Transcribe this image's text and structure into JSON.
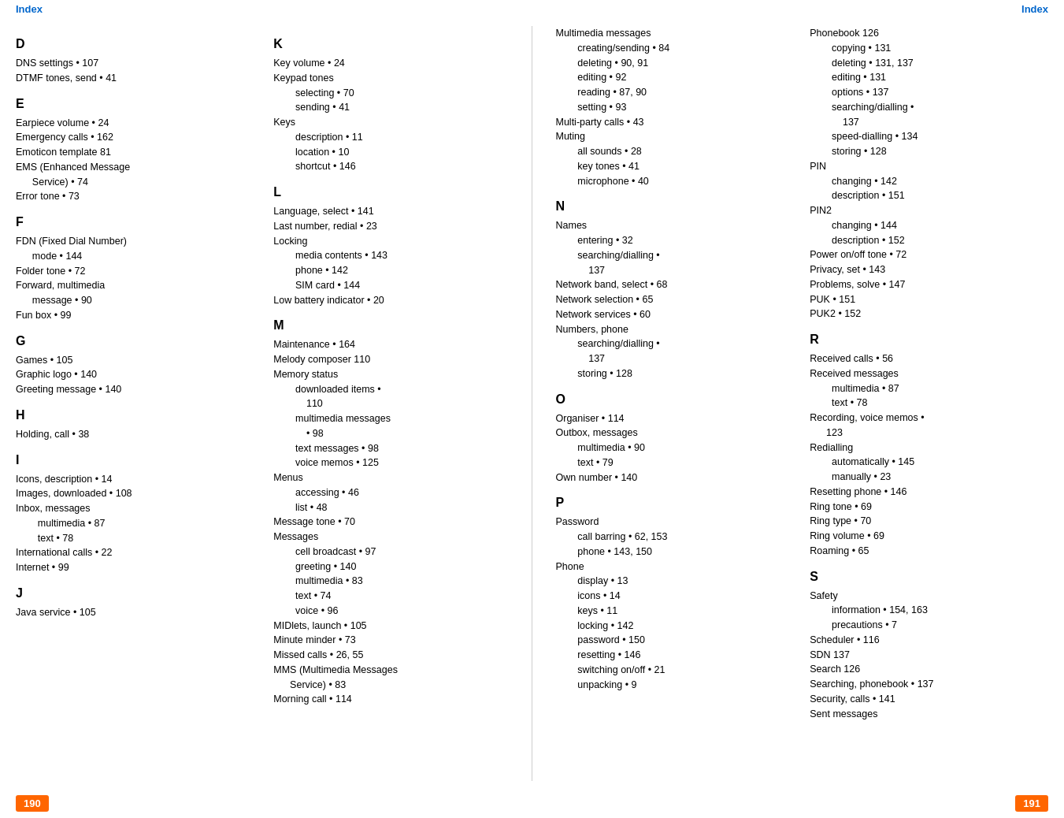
{
  "header": {
    "left_index": "Index",
    "right_index": "Index"
  },
  "footer": {
    "left_page": "190",
    "right_page": "191"
  },
  "left_page": {
    "sections": [
      {
        "letter": "D",
        "entries": [
          "DNS settings • 107",
          "DTMF tones, send • 41"
        ]
      },
      {
        "letter": "E",
        "entries": [
          "Earpiece volume • 24",
          "Emergency calls • 162",
          "Emoticon template 81",
          "EMS (Enhanced Message\n      Service) • 74",
          "Error tone • 73"
        ]
      },
      {
        "letter": "F",
        "entries": [
          "FDN (Fixed Dial Number)\n      mode • 144",
          "Folder tone • 72",
          "Forward, multimedia\n      message • 90",
          "Fun box • 99"
        ]
      },
      {
        "letter": "G",
        "entries": [
          "Games • 105",
          "Graphic logo • 140",
          "Greeting message • 140"
        ]
      },
      {
        "letter": "H",
        "entries": [
          "Holding, call • 38"
        ]
      },
      {
        "letter": "I",
        "entries": [
          "Icons, description • 14",
          "Images, downloaded • 108",
          "Inbox, messages",
          "      multimedia • 87",
          "      text • 78",
          "International calls • 22",
          "Internet • 99"
        ]
      },
      {
        "letter": "J",
        "entries": [
          "Java service • 105"
        ]
      }
    ],
    "K_section": {
      "letter": "K",
      "entries": [
        "Key volume • 24",
        "Keypad tones",
        "      selecting • 70",
        "      sending • 41",
        "Keys",
        "      description • 11",
        "      location • 10",
        "      shortcut • 146"
      ]
    },
    "L_section": {
      "letter": "L",
      "entries": [
        "Language, select • 141",
        "Last number, redial • 23",
        "Locking",
        "      media contents • 143",
        "      phone • 142",
        "      SIM card • 144",
        "Low battery indicator • 20"
      ]
    },
    "M_section": {
      "letter": "M",
      "entries": [
        "Maintenance • 164",
        "Melody composer 110",
        "Memory status",
        "      downloaded items •\n            110",
        "      multimedia messages\n            • 98",
        "      text messages • 98",
        "      voice memos • 125",
        "Menus",
        "      accessing • 46",
        "      list • 48",
        "Message tone • 70",
        "Messages",
        "      cell broadcast • 97",
        "      greeting • 140",
        "      multimedia • 83",
        "      text • 74",
        "      voice • 96",
        "MIDlets, launch • 105",
        "Minute minder • 73",
        "Missed calls • 26, 55",
        "MMS (Multimedia Messages\n      Service) • 83",
        "Morning call • 114"
      ]
    }
  },
  "right_page": {
    "multimedia_section": {
      "entries": [
        "Multimedia messages",
        "      creating/sending • 84",
        "      deleting • 90, 91",
        "      editing • 92",
        "      reading • 87, 90",
        "      setting • 93",
        "Multi-party calls • 43",
        "Muting",
        "      all sounds • 28",
        "      key tones • 41",
        "      microphone • 40"
      ]
    },
    "N_section": {
      "letter": "N",
      "entries": [
        "Names",
        "      entering • 32",
        "      searching/dialling •\n            137",
        "Network band, select • 68",
        "Network selection • 65",
        "Network services • 60",
        "Numbers, phone",
        "      searching/dialling •\n            137",
        "      storing • 128"
      ]
    },
    "O_section": {
      "letter": "O",
      "entries": [
        "Organiser • 114",
        "Outbox, messages",
        "      multimedia • 90",
        "      text • 79",
        "Own number • 140"
      ]
    },
    "P_section": {
      "letter": "P",
      "entries": [
        "Password",
        "      call barring • 62, 153",
        "      phone • 143, 150",
        "Phone",
        "      display • 13",
        "      icons • 14",
        "      keys • 11",
        "      locking • 142",
        "      password • 150",
        "      resetting • 146",
        "      switching on/off • 21",
        "      unpacking • 9"
      ]
    },
    "phonebook_section": {
      "entries": [
        "Phonebook 126",
        "      copying • 131",
        "      deleting • 131, 137",
        "      editing • 131",
        "      options • 137",
        "      searching/dialling •\n            137",
        "      speed-dialling • 134",
        "      storing • 128",
        "PIN",
        "      changing • 142",
        "      description • 151",
        "PIN2",
        "      changing • 144",
        "      description • 152",
        "Power on/off tone • 72",
        "Privacy, set • 143",
        "Problems, solve • 147",
        "PUK • 151",
        "PUK2 • 152"
      ]
    },
    "R_section": {
      "letter": "R",
      "entries": [
        "Received calls • 56",
        "Received messages",
        "      multimedia • 87",
        "      text • 78",
        "Recording, voice memos •\n      123",
        "Redialling",
        "      automatically • 145",
        "      manually • 23",
        "Resetting phone • 146",
        "Ring tone • 69",
        "Ring type • 70",
        "Ring volume • 69",
        "Roaming • 65"
      ]
    },
    "S_section": {
      "letter": "S",
      "entries": [
        "Safety",
        "      information • 154, 163",
        "      precautions • 7",
        "Scheduler • 116",
        "SDN 137",
        "Search 126",
        "Searching, phonebook • 137",
        "Security, calls • 141",
        "Sent messages"
      ]
    }
  }
}
